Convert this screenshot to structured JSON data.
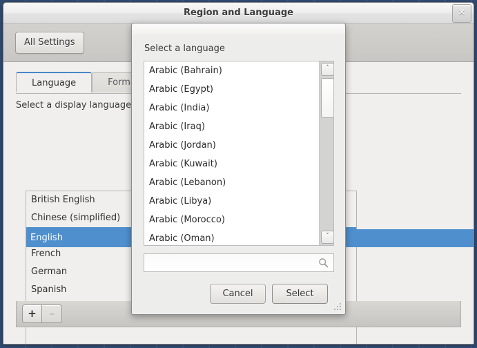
{
  "window": {
    "title": "Region and Language",
    "close_label": "✕"
  },
  "toolbar": {
    "all_settings_label": "All Settings"
  },
  "content": {
    "tabs": [
      {
        "label": "Language",
        "active": true
      },
      {
        "label": "Formats",
        "active": false
      }
    ],
    "section_label": "Select a display language",
    "language_list": [
      {
        "label": "British English",
        "selected": false
      },
      {
        "label": "Chinese (simplified)",
        "selected": false
      },
      {
        "label": "English",
        "selected": true
      },
      {
        "label": "French",
        "selected": false
      },
      {
        "label": "German",
        "selected": false
      },
      {
        "label": "Spanish",
        "selected": false
      }
    ],
    "selected_language": "English",
    "add_button_label": "+",
    "remove_button_label": "–"
  },
  "dialog": {
    "title": "Select a language",
    "list": [
      "Arabic (Bahrain)",
      "Arabic (Egypt)",
      "Arabic (India)",
      "Arabic (Iraq)",
      "Arabic (Jordan)",
      "Arabic (Kuwait)",
      "Arabic (Lebanon)",
      "Arabic (Libya)",
      "Arabic (Morocco)",
      "Arabic (Oman)"
    ],
    "search": {
      "value": "",
      "placeholder": "",
      "icon": "search-icon"
    },
    "scrollbar": {
      "up_arrow": "˄",
      "down_arrow": "˅"
    },
    "cancel_label": "Cancel",
    "select_label": "Select"
  },
  "colors": {
    "selection_blue": "#4f8fce",
    "tab_accent": "#4a86c8",
    "desktop": "#2d4771"
  }
}
